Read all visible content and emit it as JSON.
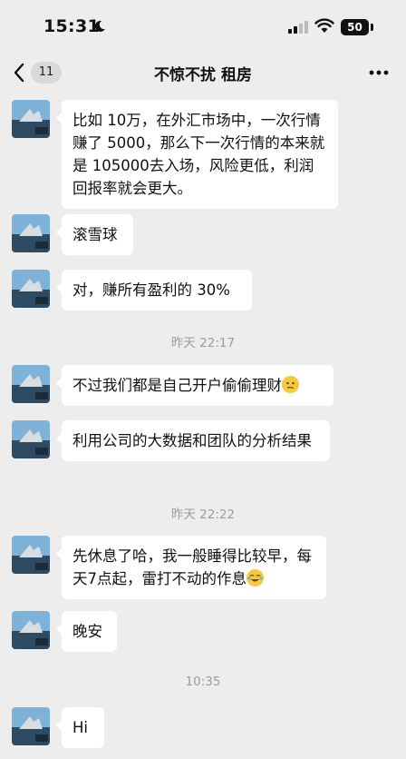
{
  "status_bar": {
    "time": "15:31",
    "battery": "50"
  },
  "nav": {
    "back_count": "11",
    "title": "不惊不扰 租房"
  },
  "messages": [
    {
      "type": "text",
      "text": "比如 10万，在外汇市场中，一次行情赚了 5000，那么下一次行情的本来就是 105000去入场，风险更低，利润回报率就会更大。"
    },
    {
      "type": "text",
      "text": "滚雪球"
    },
    {
      "type": "text",
      "text": "对，赚所有盈利的 30%"
    },
    {
      "type": "time",
      "text": "昨天 22:17"
    },
    {
      "type": "text",
      "text": "不过我们都是自己开户偷偷理财",
      "emoji": "thinking-face-icon"
    },
    {
      "type": "text",
      "text": "利用公司的大数据和团队的分析结果"
    },
    {
      "type": "time",
      "text": "昨天 22:22"
    },
    {
      "type": "text",
      "text": "先休息了哈，我一般睡得比较早，每天7点起，雷打不动的作息",
      "emoji": "laughing-tears-icon"
    },
    {
      "type": "text",
      "text": "晚安"
    },
    {
      "type": "time",
      "text": "10:35"
    },
    {
      "type": "text",
      "text": "Hi"
    }
  ]
}
